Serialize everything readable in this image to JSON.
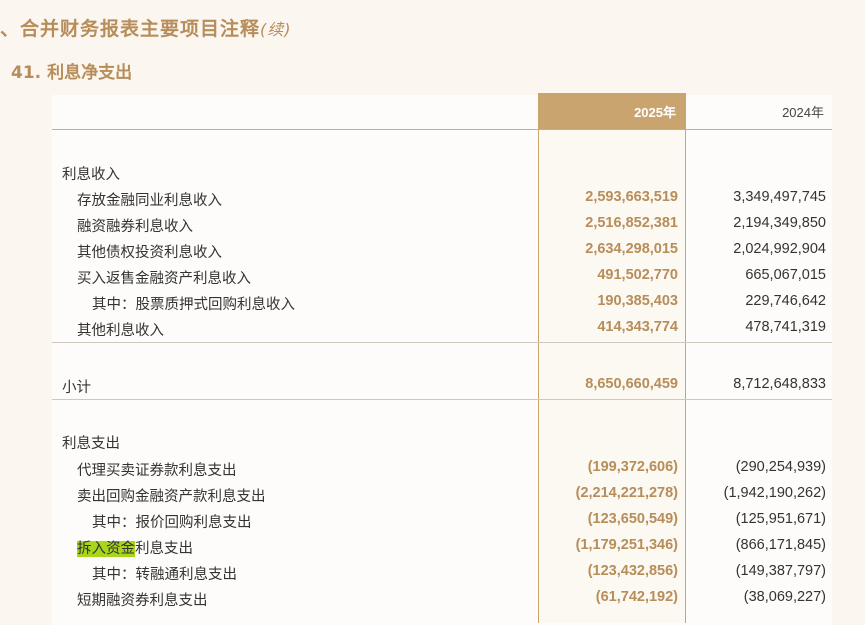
{
  "section_title": "、合并财务报表主要项目注释",
  "section_title_cont": "(续)",
  "note_number": "41.",
  "note_title": "利息净支出",
  "columns": {
    "current": "2025年",
    "previous": "2024年"
  },
  "rows": [
    {
      "label": "利息收入",
      "v25": "",
      "v24": "",
      "indent": 0
    },
    {
      "label": "存放金融同业利息收入",
      "v25": "2,593,663,519",
      "v24": "3,349,497,745",
      "indent": 1
    },
    {
      "label": "融资融券利息收入",
      "v25": "2,516,852,381",
      "v24": "2,194,349,850",
      "indent": 1
    },
    {
      "label": "其他债权投资利息收入",
      "v25": "2,634,298,015",
      "v24": "2,024,992,904",
      "indent": 1
    },
    {
      "label": "买入返售金融资产利息收入",
      "v25": "491,502,770",
      "v24": "665,067,015",
      "indent": 1
    },
    {
      "label": "其中：股票质押式回购利息收入",
      "v25": "190,385,403",
      "v24": "229,746,642",
      "indent": 2
    },
    {
      "label": "其他利息收入",
      "v25": "414,343,774",
      "v24": "478,741,319",
      "indent": 1
    },
    {
      "label": "小计",
      "v25": "8,650,660,459",
      "v24": "8,712,648,833",
      "indent": 0
    },
    {
      "label": "利息支出",
      "v25": "",
      "v24": "",
      "indent": 0
    },
    {
      "label": "代理买卖证券款利息支出",
      "v25": "(199,372,606)",
      "v24": "(290,254,939)",
      "indent": 1
    },
    {
      "label": "卖出回购金融资产款利息支出",
      "v25": "(2,214,221,278)",
      "v24": "(1,942,190,262)",
      "indent": 1
    },
    {
      "label": "其中：报价回购利息支出",
      "v25": "(123,650,549)",
      "v24": "(125,951,671)",
      "indent": 2
    },
    {
      "label_highlight": "拆入资金",
      "label_rest": "利息支出",
      "v25": "(1,179,251,346)",
      "v24": "(866,171,845)",
      "indent": 1
    },
    {
      "label": "其中：转融通利息支出",
      "v25": "(123,432,856)",
      "v24": "(149,387,797)",
      "indent": 2
    },
    {
      "label": "短期融资券利息支出",
      "v25": "(61,742,192)",
      "v24": "(38,069,227)",
      "indent": 1
    }
  ]
}
